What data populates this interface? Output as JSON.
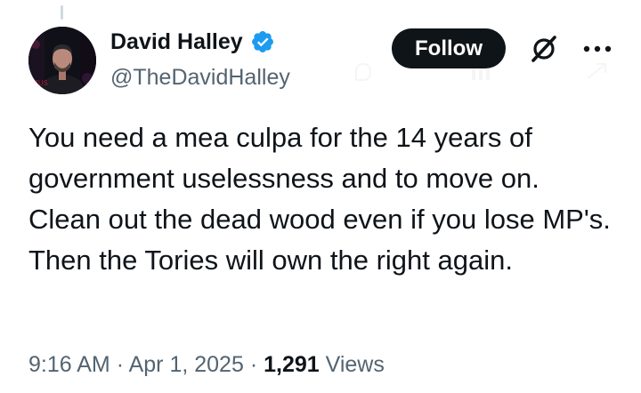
{
  "author": {
    "display_name": "David Halley",
    "handle": "@TheDavidHalley",
    "verified": true
  },
  "header": {
    "follow_label": "Follow"
  },
  "icons": {
    "verified": "verified-badge-icon",
    "grok": "grok-icon",
    "more": "more-options-icon"
  },
  "tweet": {
    "text": "You need a mea culpa for the 14 years of government uselessness and to move on. Clean out the dead wood even if you lose MP's. Then the Tories will own the right again.",
    "time": "9:16 AM",
    "separator": "·",
    "date": "Apr 1, 2025",
    "views_count": "1,291",
    "views_label": "Views"
  },
  "colors": {
    "text_primary": "#0f1419",
    "text_secondary": "#536471",
    "verified_blue": "#1d9bf0",
    "follow_button_bg": "#0f1419",
    "thread_line": "#cfd9de"
  }
}
